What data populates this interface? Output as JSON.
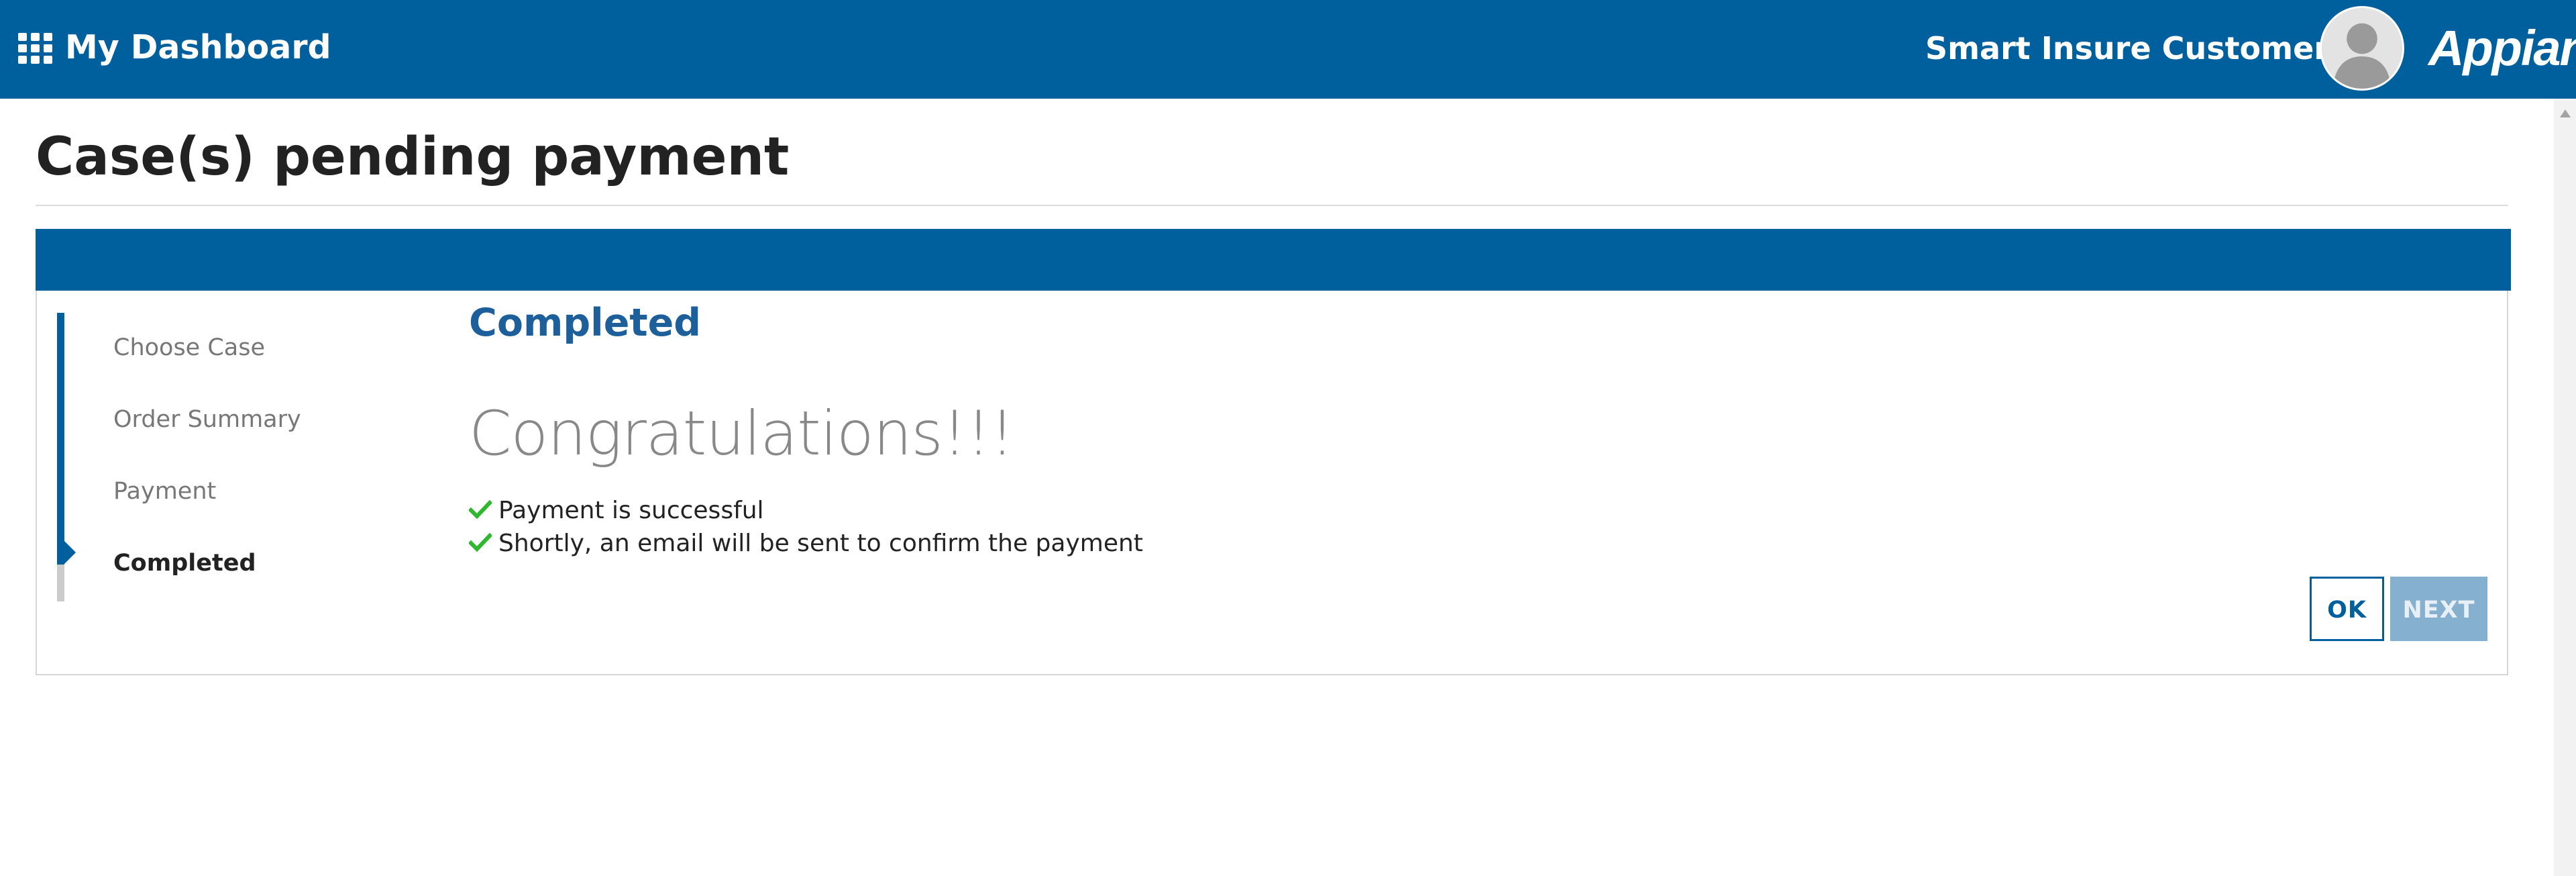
{
  "header": {
    "title": "My Dashboard",
    "user_name": "Smart Insure Customer",
    "brand": "Appian",
    "icons": {
      "app_menu": "grid-icon",
      "user_caret": "caret-down-icon",
      "avatar": "user-avatar-icon"
    },
    "colors": {
      "bar": "#00609d",
      "text": "#ffffff"
    }
  },
  "page": {
    "title": "Case(s) pending payment"
  },
  "wizard": {
    "steps": [
      {
        "label": "Choose Case",
        "state": "done"
      },
      {
        "label": "Order Summary",
        "state": "done"
      },
      {
        "label": "Payment",
        "state": "done"
      },
      {
        "label": "Completed",
        "state": "current"
      }
    ],
    "section_heading": "Completed",
    "headline": "Congratulations!!!",
    "messages": [
      "Payment is successful",
      "Shortly, an email will be sent to confirm the payment"
    ],
    "message_icon": "checkmark-icon",
    "colors": {
      "accent": "#00609d",
      "heading": "#1d5f9b",
      "check": "#2eb82e"
    },
    "buttons": {
      "ok": "OK",
      "next": "NEXT"
    }
  }
}
